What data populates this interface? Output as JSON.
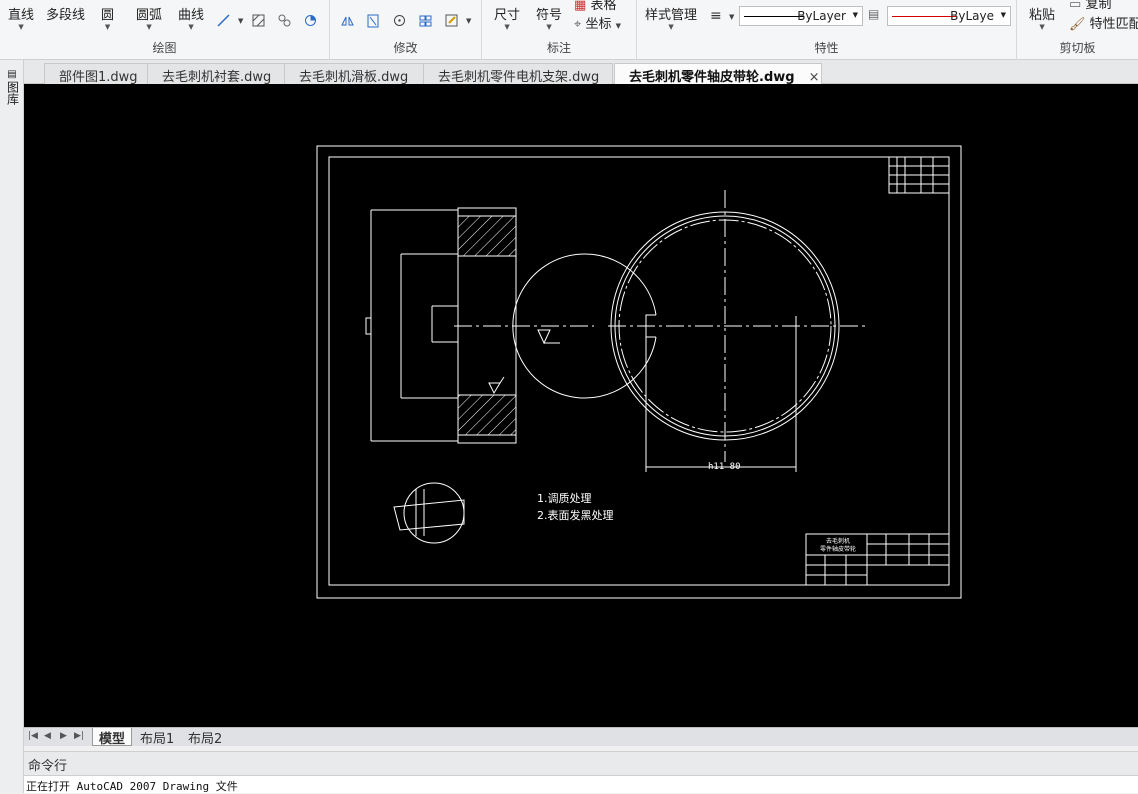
{
  "ribbon": {
    "draw": {
      "title": "绘图",
      "line": "直线",
      "polyline": "多段线",
      "circle": "圆",
      "arc": "圆弧",
      "curve": "曲线"
    },
    "modify": {
      "title": "修改"
    },
    "annotate": {
      "title": "标注",
      "dimension": "尺寸",
      "symbol": "符号",
      "table": "表格",
      "coordinate": "坐标"
    },
    "properties": {
      "title": "特性",
      "style_manager": "样式管理",
      "linetype_value": "ByLayer",
      "color_value": "ByLaye"
    },
    "clipboard": {
      "title": "剪切板",
      "paste": "粘贴",
      "copy": "复制",
      "match_properties": "特性匹配"
    }
  },
  "left_strip": {
    "label": "图库"
  },
  "doc_tabs": [
    {
      "label": "部件图1.dwg"
    },
    {
      "label": "去毛刺机衬套.dwg"
    },
    {
      "label": "去毛刺机滑板.dwg"
    },
    {
      "label": "去毛刺机零件电机支架.dwg"
    },
    {
      "label": "去毛刺机零件轴皮带轮.dwg"
    }
  ],
  "active_tab_close": "×",
  "drawing": {
    "notes": [
      "1.调质处理",
      "2.表面发黑处理"
    ],
    "title_block_name": [
      "去毛刺机",
      "零件轴皮带轮"
    ],
    "dimension_text": "h11 80"
  },
  "layout_tabs": [
    {
      "label": "模型"
    },
    {
      "label": "布局1"
    },
    {
      "label": "布局2"
    }
  ],
  "command": {
    "title": "命令行",
    "history_line": "正在打开 AutoCAD 2007 Drawing 文件"
  },
  "colors": {
    "canvas_bg": "#000000",
    "drawing_line": "#ffffff",
    "color_combo_line": "#d40000"
  }
}
